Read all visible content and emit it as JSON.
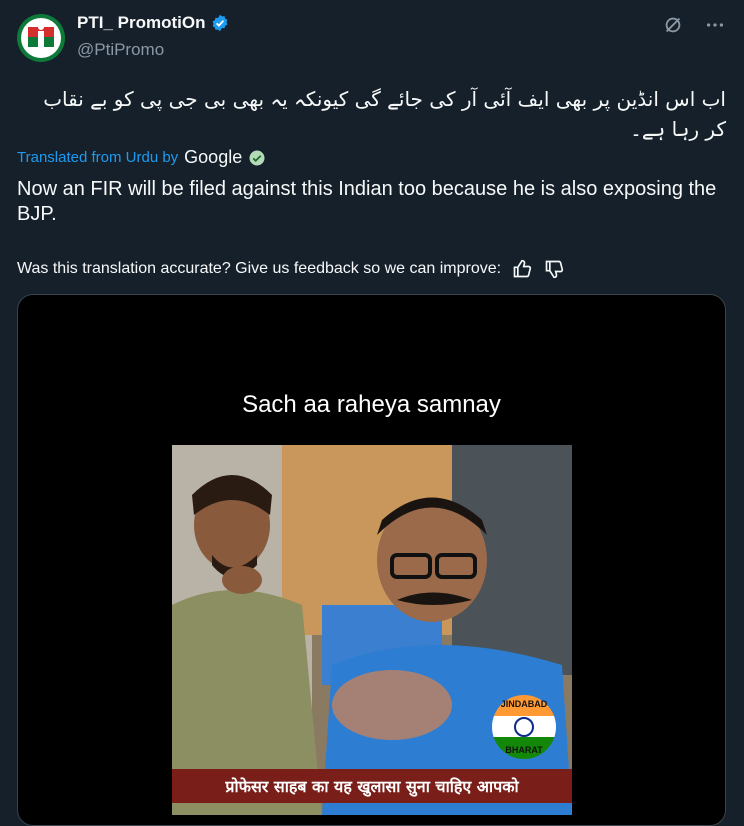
{
  "author": {
    "display_name": "PTI_ PromotiOn",
    "handle": "@PtiPromo",
    "avatar_icon": "pti-logo-icon",
    "verified_icon": "verified-badge-icon"
  },
  "header_icons": [
    "grok-icon",
    "more-icon"
  ],
  "tweet": {
    "original_text": "اب اس انڈین پر بھی ایف آئی آر کی جائے گی کیونکہ یہ بھی بی جی پی کو بے نقاب کر رہا ہے۔",
    "translated_from": "Translated from Urdu by",
    "translator": "Google",
    "translation": "Now an FIR will be filed against this Indian too because he is also exposing the BJP.",
    "feedback_prompt": "Was this translation accurate? Give us feedback so we can improve:"
  },
  "media": {
    "video_caption": "Sach aa raheya samnay",
    "badge_top": "JINDABAD",
    "badge_bottom": "BHARAT",
    "hindi_subtitle": "प्रोफेसर साहब का यह खुलासा सुना चाहिए आपको"
  },
  "colors": {
    "background": "#15202b",
    "accent": "#1d9bf0",
    "secondary_text": "#8b98a5"
  }
}
